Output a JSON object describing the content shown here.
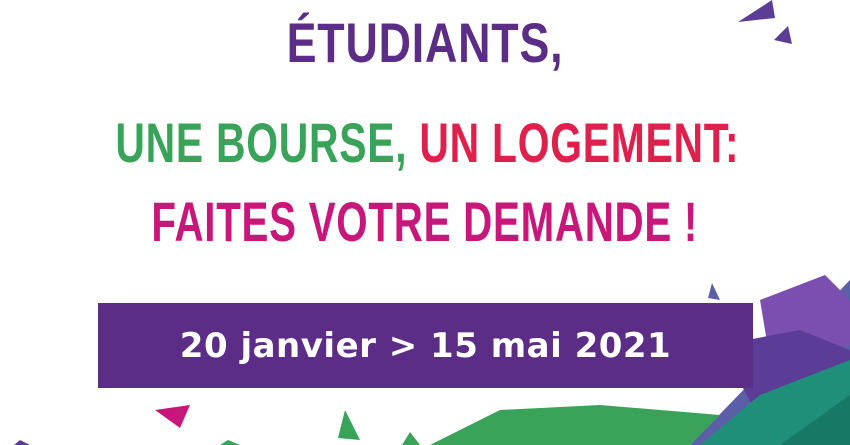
{
  "headline": {
    "line1": {
      "text": "ÉTUDIANTS,",
      "color": "#5b2d86"
    },
    "line2": [
      {
        "text": "UNE BOURSE,",
        "color": "#3aa35a"
      },
      {
        "text": "UN LOGEMENT:",
        "color": "#e0204c"
      }
    ],
    "line3": {
      "text": "FAITES VOTRE DEMANDE !",
      "color": "#c8177b"
    }
  },
  "date_banner": {
    "text": "20 janvier > 15 mai 2021",
    "background_color": "#5b2d86",
    "text_color": "#ffffff"
  },
  "decor_colors": {
    "purple": "#5b3d98",
    "violet": "#7a4fb0",
    "magenta": "#c8177b",
    "green": "#3aa35a",
    "teal": "#1f8f7a",
    "teal_dark": "#187866",
    "blue_violet": "#5a5fa8"
  }
}
